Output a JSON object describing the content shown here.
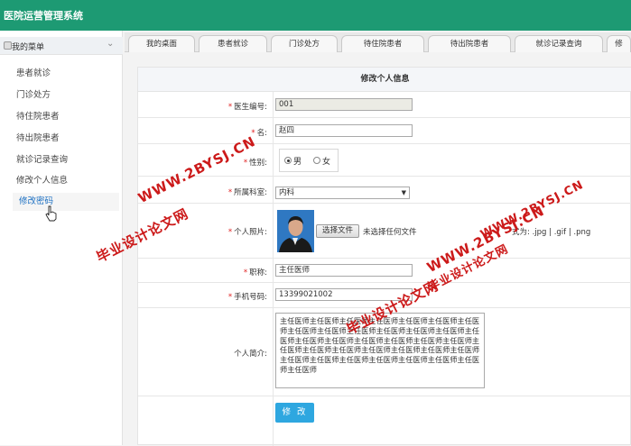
{
  "app": {
    "title": "医院运营管理系统"
  },
  "sidebar": {
    "header": "我的菜单",
    "items": [
      {
        "label": "患者就诊"
      },
      {
        "label": "门诊处方"
      },
      {
        "label": "待住院患者"
      },
      {
        "label": "待出院患者"
      },
      {
        "label": "就诊记录查询"
      },
      {
        "label": "修改个人信息"
      },
      {
        "label": "修改密码"
      }
    ]
  },
  "tabs": [
    {
      "label": "我的桌面"
    },
    {
      "label": "患者就诊"
    },
    {
      "label": "门诊处方"
    },
    {
      "label": "待住院患者"
    },
    {
      "label": "待出院患者"
    },
    {
      "label": "就诊记录查询"
    },
    {
      "label": "修"
    }
  ],
  "form": {
    "title": "修改个人信息",
    "doctor_id": {
      "label": "医生编号:",
      "value": "001"
    },
    "name": {
      "label": "名:",
      "value": "赵四"
    },
    "gender": {
      "label": "性别:",
      "options": [
        "男",
        "女"
      ],
      "selected": "男"
    },
    "department": {
      "label": "所属科室:",
      "value": "内科"
    },
    "photo": {
      "label": "个人照片:",
      "button": "选择文件",
      "status": "未选择任何文件",
      "hint": "式为: .jpg | .gif | .png"
    },
    "title_field": {
      "label": "职称:",
      "value": "主任医师"
    },
    "phone": {
      "label": "手机号码:",
      "value": "13399021002"
    },
    "bio": {
      "label": "个人简介:",
      "value": "主任医师主任医师主任医师主任医师主任医师主任医师主任医师主任医师主任医师主任医师主任医师主任医师主任医师主任医师主任医师主任医师主任医师主任医师主任医师主任医师主任医师主任医师主任医师主任医师主任医师主任医师主任医师主任医师主任医师主任医师主任医师主任医师主任医师主任医师主任医师"
    },
    "submit": "修 改"
  },
  "watermarks": [
    {
      "text": "WWW.2BYSJ.CN"
    },
    {
      "text": "毕业设计论文网"
    },
    {
      "text": "WWW.2BYSJ.CN"
    },
    {
      "text": "毕业设计论文网"
    },
    {
      "text": "WWW.2BYSJ.CN"
    },
    {
      "text": "毕业设计论文网"
    }
  ],
  "colors": {
    "brand": "#1d9a73",
    "accent": "#2ea7e0",
    "required": "#e02020",
    "watermark": "#cc1a1a"
  }
}
